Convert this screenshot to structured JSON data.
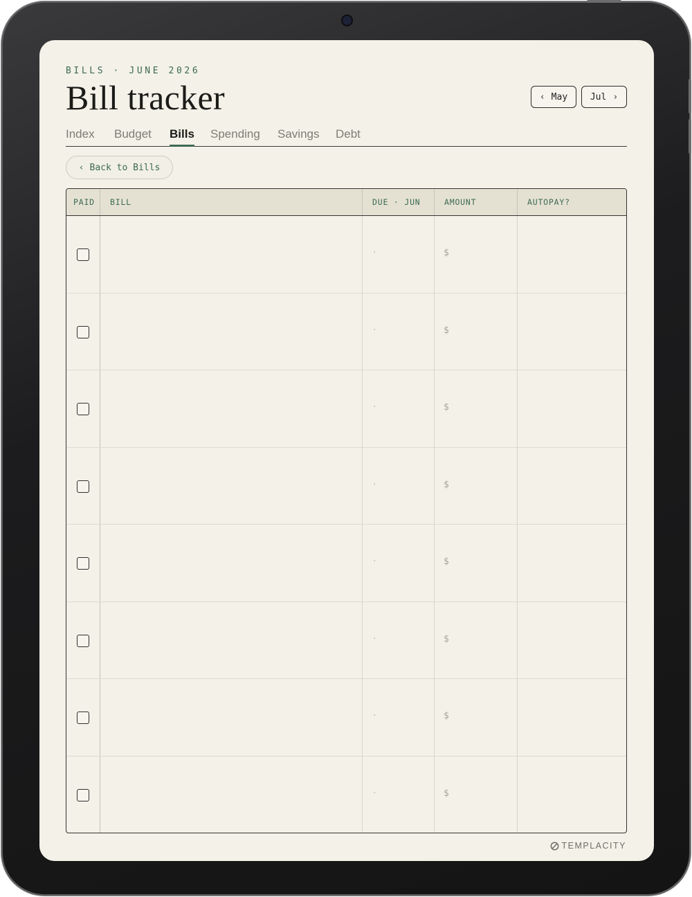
{
  "header": {
    "eyebrow": "BILLS · JUNE 2026",
    "title": "Bill tracker",
    "prev_month": "May",
    "next_month": "Jul"
  },
  "tabs": [
    {
      "label": "Index",
      "active": false
    },
    {
      "label": "Budget",
      "active": false
    },
    {
      "label": "Bills",
      "active": true
    },
    {
      "label": "Spending",
      "active": false
    },
    {
      "label": "Savings",
      "active": false
    },
    {
      "label": "Debt",
      "active": false
    }
  ],
  "back_button": "Back to Bills",
  "table": {
    "columns": [
      "PAID",
      "BILL",
      "DUE · JUN",
      "AMOUNT",
      "AUTOPAY?"
    ],
    "rows": [
      {
        "due": "·",
        "amount": "$"
      },
      {
        "due": "·",
        "amount": "$"
      },
      {
        "due": "·",
        "amount": "$"
      },
      {
        "due": "·",
        "amount": "$"
      },
      {
        "due": "·",
        "amount": "$"
      },
      {
        "due": "·",
        "amount": "$"
      },
      {
        "due": "·",
        "amount": "$"
      },
      {
        "due": "·",
        "amount": "$"
      }
    ]
  },
  "brand": "TEMPLACITY",
  "colors": {
    "accent": "#3d6a52",
    "paper": "#f3f1e8",
    "header_bg": "#e4e1d3",
    "ink": "#1b1b18"
  },
  "icons": {
    "prev": "chevron-left-icon",
    "next": "chevron-right-icon",
    "back": "chevron-left-icon",
    "brand": "templacity-logo-icon"
  }
}
